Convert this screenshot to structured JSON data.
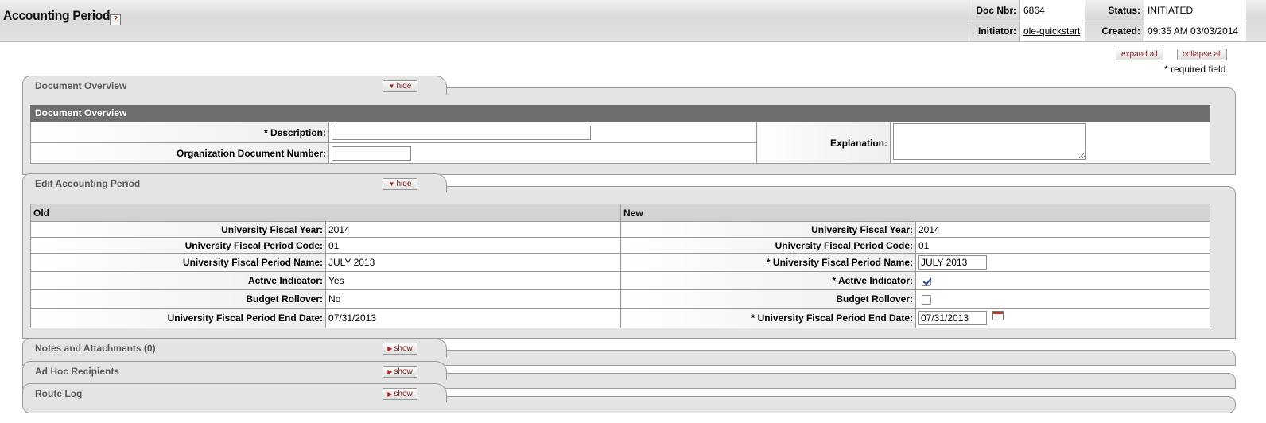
{
  "header": {
    "title": "Accounting Period",
    "help_icon": "help-icon",
    "doc_nbr_label": "Doc Nbr:",
    "doc_nbr": "6864",
    "status_label": "Status:",
    "status": "INITIATED",
    "initiator_label": "Initiator:",
    "initiator": "ole-quickstart",
    "created_label": "Created:",
    "created": "09:35 AM 03/03/2014"
  },
  "toolbar": {
    "expand_all": "expand all",
    "collapse_all": "collapse all",
    "required_note": "* required field"
  },
  "tabs": {
    "document_overview": {
      "label": "Document Overview",
      "toggle": "hide"
    },
    "edit_accounting_period": {
      "label": "Edit Accounting Period",
      "toggle": "hide"
    },
    "notes": {
      "label": "Notes and Attachments (0)",
      "toggle": "show"
    },
    "adhoc": {
      "label": "Ad Hoc Recipients",
      "toggle": "show"
    },
    "route_log": {
      "label": "Route Log",
      "toggle": "show"
    }
  },
  "overview": {
    "section_title": "Document Overview",
    "description_label": "*  Description:",
    "description_value": "",
    "org_doc_number_label": "Organization Document Number:",
    "org_doc_number_value": "",
    "explanation_label": "Explanation:",
    "explanation_value": ""
  },
  "edit": {
    "old_header": "Old",
    "new_header": "New",
    "rows": [
      {
        "old_label": "University Fiscal Year:",
        "old_value": "2014",
        "new_label": "University Fiscal Year:",
        "new_value": "2014"
      },
      {
        "old_label": "University Fiscal Period Code:",
        "old_value": "01",
        "new_label": "University Fiscal Period Code:",
        "new_value": "01"
      },
      {
        "old_label": "University Fiscal Period Name:",
        "old_value": "JULY 2013",
        "new_label": "*  University Fiscal Period Name:",
        "new_value": "JULY 2013"
      },
      {
        "old_label": "Active Indicator:",
        "old_value": "Yes",
        "new_label": "*  Active Indicator:",
        "new_checked": true
      },
      {
        "old_label": "Budget Rollover:",
        "old_value": "No",
        "new_label": "Budget Rollover:",
        "new_checked": false
      },
      {
        "old_label": "University Fiscal Period End Date:",
        "old_value": "07/31/2013",
        "new_label": "*  University Fiscal Period End Date:",
        "new_value": "07/31/2013"
      }
    ]
  }
}
